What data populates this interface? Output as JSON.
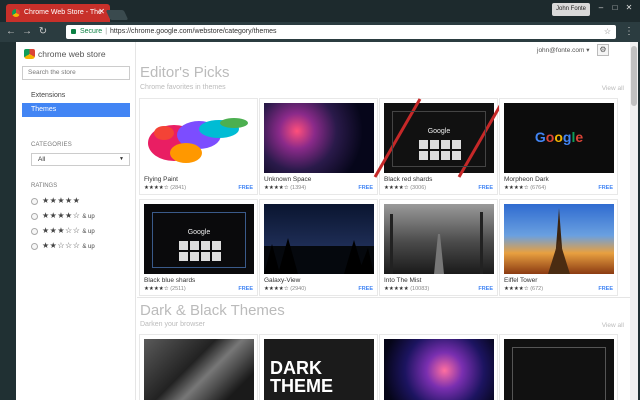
{
  "browser": {
    "tab_title": "Chrome Web Store - The",
    "user": "John Fonte",
    "url_secure": "Secure",
    "url": "https://chrome.google.com/webstore/category/themes"
  },
  "sidebar": {
    "logo": "chrome web store",
    "search_placeholder": "Search the store",
    "nav": {
      "extensions": "Extensions",
      "themes": "Themes"
    },
    "categories_label": "CATEGORIES",
    "category_value": "All",
    "ratings_label": "RATINGS",
    "ratings": [
      {
        "stars": "★★★★★",
        "suffix": ""
      },
      {
        "stars": "★★★★☆",
        "suffix": "& up"
      },
      {
        "stars": "★★★☆☆",
        "suffix": "& up"
      },
      {
        "stars": "★★☆☆☆",
        "suffix": "& up"
      }
    ]
  },
  "header": {
    "account": "john@fonte.com ▾"
  },
  "sections": [
    {
      "title": "Editor's Picks",
      "subtitle": "Chrome favorites in themes",
      "view_all": "View all",
      "items": [
        {
          "name": "Flying Paint",
          "stars": "★★★★☆",
          "count": "(2841)",
          "price": "FREE"
        },
        {
          "name": "Unknown Space",
          "stars": "★★★★☆",
          "count": "(1394)",
          "price": "FREE"
        },
        {
          "name": "Black red shards",
          "stars": "★★★★☆",
          "count": "(3006)",
          "price": "FREE"
        },
        {
          "name": "Morpheon Dark",
          "stars": "★★★★☆",
          "count": "(6764)",
          "price": "FREE"
        },
        {
          "name": "Black blue shards",
          "stars": "★★★★☆",
          "count": "(2511)",
          "price": "FREE"
        },
        {
          "name": "Galaxy-View",
          "stars": "★★★★☆",
          "count": "(2940)",
          "price": "FREE"
        },
        {
          "name": "Into The Mist",
          "stars": "★★★★★",
          "count": "(10083)",
          "price": "FREE"
        },
        {
          "name": "Eiffel Tower",
          "stars": "★★★★☆",
          "count": "(672)",
          "price": "FREE"
        }
      ]
    },
    {
      "title": "Dark & Black Themes",
      "subtitle": "Darken your browser",
      "view_all": "View all"
    }
  ],
  "thumb_text": {
    "google": "Google",
    "dark_theme": "DARK THEME"
  }
}
